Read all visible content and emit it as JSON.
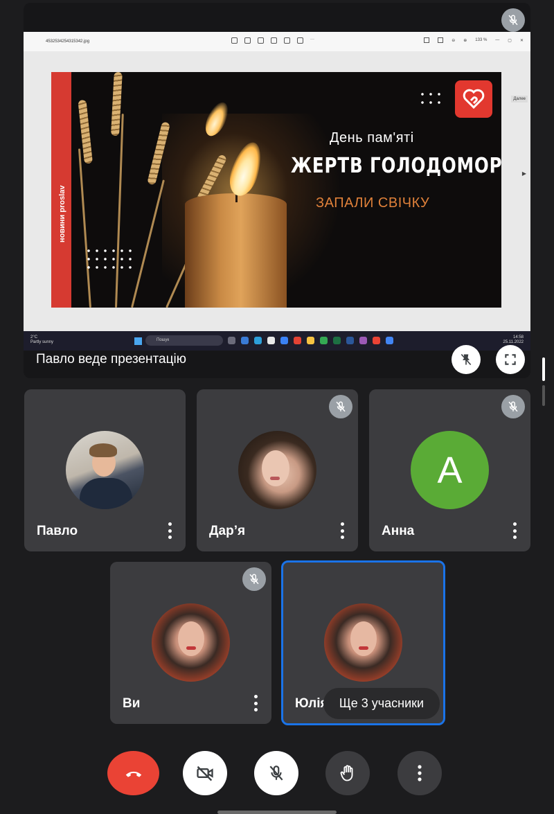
{
  "presentation": {
    "presenter_label": "Павло веде презентацію",
    "file_name": "4532534254315342.jpg",
    "zoom": "133 %",
    "next_label": "Далее",
    "slide": {
      "line1": "День пам'яті",
      "line2": "ЖЕРТВ ГОЛОДОМОРІВ",
      "line3": "ЗАПАЛИ СВІЧКУ",
      "side_text": "новини proslav"
    },
    "taskbar": {
      "weather_temp": "2°C",
      "weather_desc": "Partly sunny",
      "search_placeholder": "Пошук",
      "time": "14:58",
      "date": "25.11.2022"
    }
  },
  "participants": [
    {
      "name": "Павло",
      "muted": false,
      "avatar": "photo"
    },
    {
      "name": "Дар’я",
      "muted": true,
      "avatar": "photo"
    },
    {
      "name": "Анна",
      "muted": true,
      "avatar": "letter",
      "letter": "A",
      "avatar_color": "#5aab36"
    },
    {
      "name": "Ви",
      "muted": true,
      "avatar": "photo"
    },
    {
      "name": "Юлія",
      "muted": false,
      "avatar": "photo",
      "active": true
    }
  ],
  "more_participants_label": "Ще 3 учасники",
  "controls": {
    "end_call_color": "#ea4335",
    "accent_color": "#1a73e8"
  }
}
